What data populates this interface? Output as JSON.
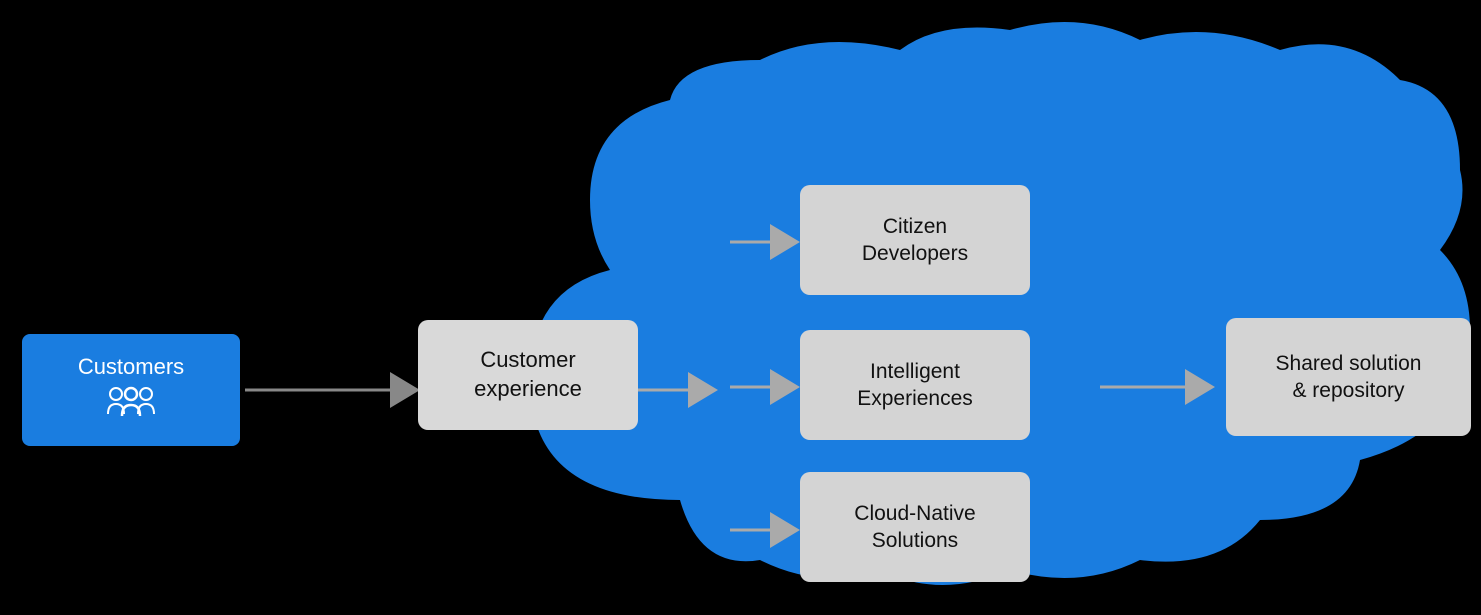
{
  "background": "#000000",
  "cloud_color": "#1a7de0",
  "customers": {
    "label": "Customers",
    "icon": "👥",
    "bg_color": "#1a7de0"
  },
  "customer_experience": {
    "label": "Customer\nexperience",
    "label_line1": "Customer",
    "label_line2": "experience"
  },
  "boxes": [
    {
      "id": "citizen",
      "label_line1": "Citizen",
      "label_line2": "Developers"
    },
    {
      "id": "intelligent",
      "label_line1": "Intelligent",
      "label_line2": "Experiences"
    },
    {
      "id": "cloud_native",
      "label_line1": "Cloud-Native",
      "label_line2": "Solutions"
    }
  ],
  "shared_solution": {
    "label_line1": "Shared solution",
    "label_line2": "& repository"
  },
  "arrows": {
    "color": "#aaaaaa"
  }
}
